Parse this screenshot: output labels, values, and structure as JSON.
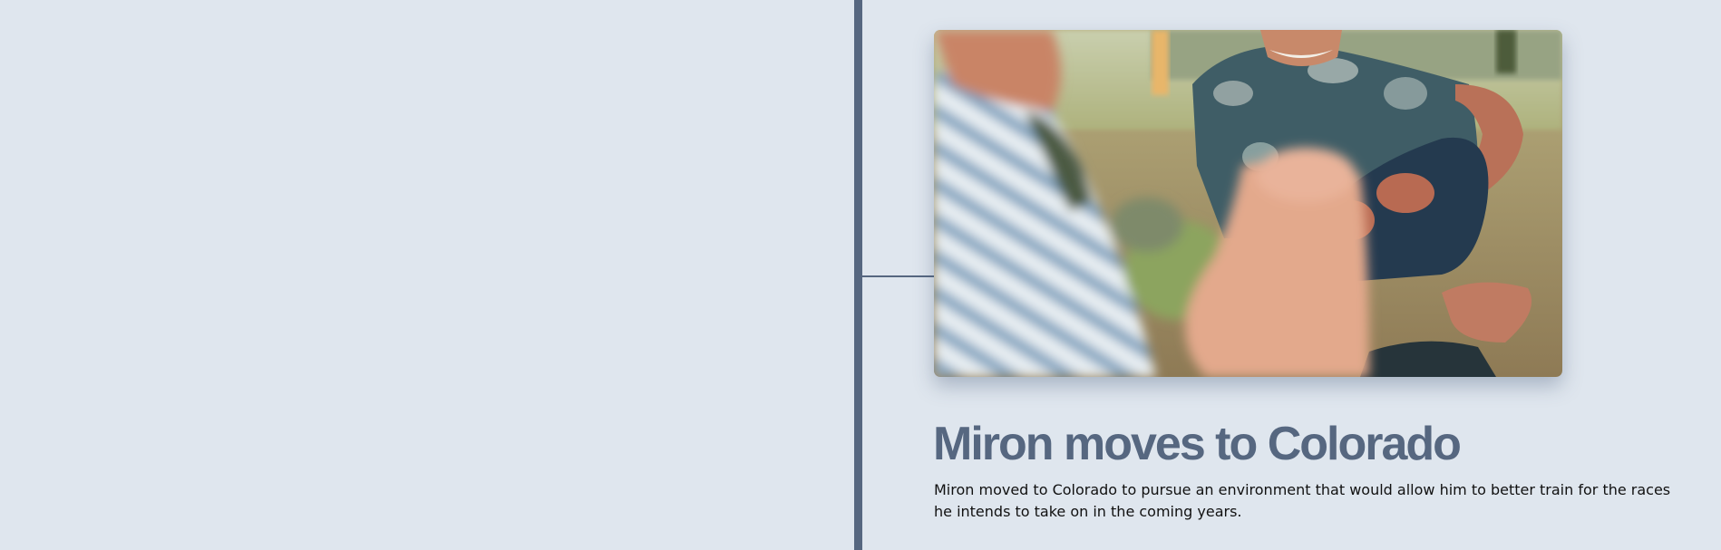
{
  "entry": {
    "title": "Miron moves to Colorado",
    "description": "Miron moved to Colorado to pursue an environment that would allow him to better train for the races he intends to take on in the coming years.",
    "image_alt": "Two men sitting on grass, one with a tattooed arm and a watch, holding a small plant"
  },
  "colors": {
    "background": "#dfe6ee",
    "timeline": "#566780",
    "title": "#566780",
    "body_text": "#111111"
  }
}
